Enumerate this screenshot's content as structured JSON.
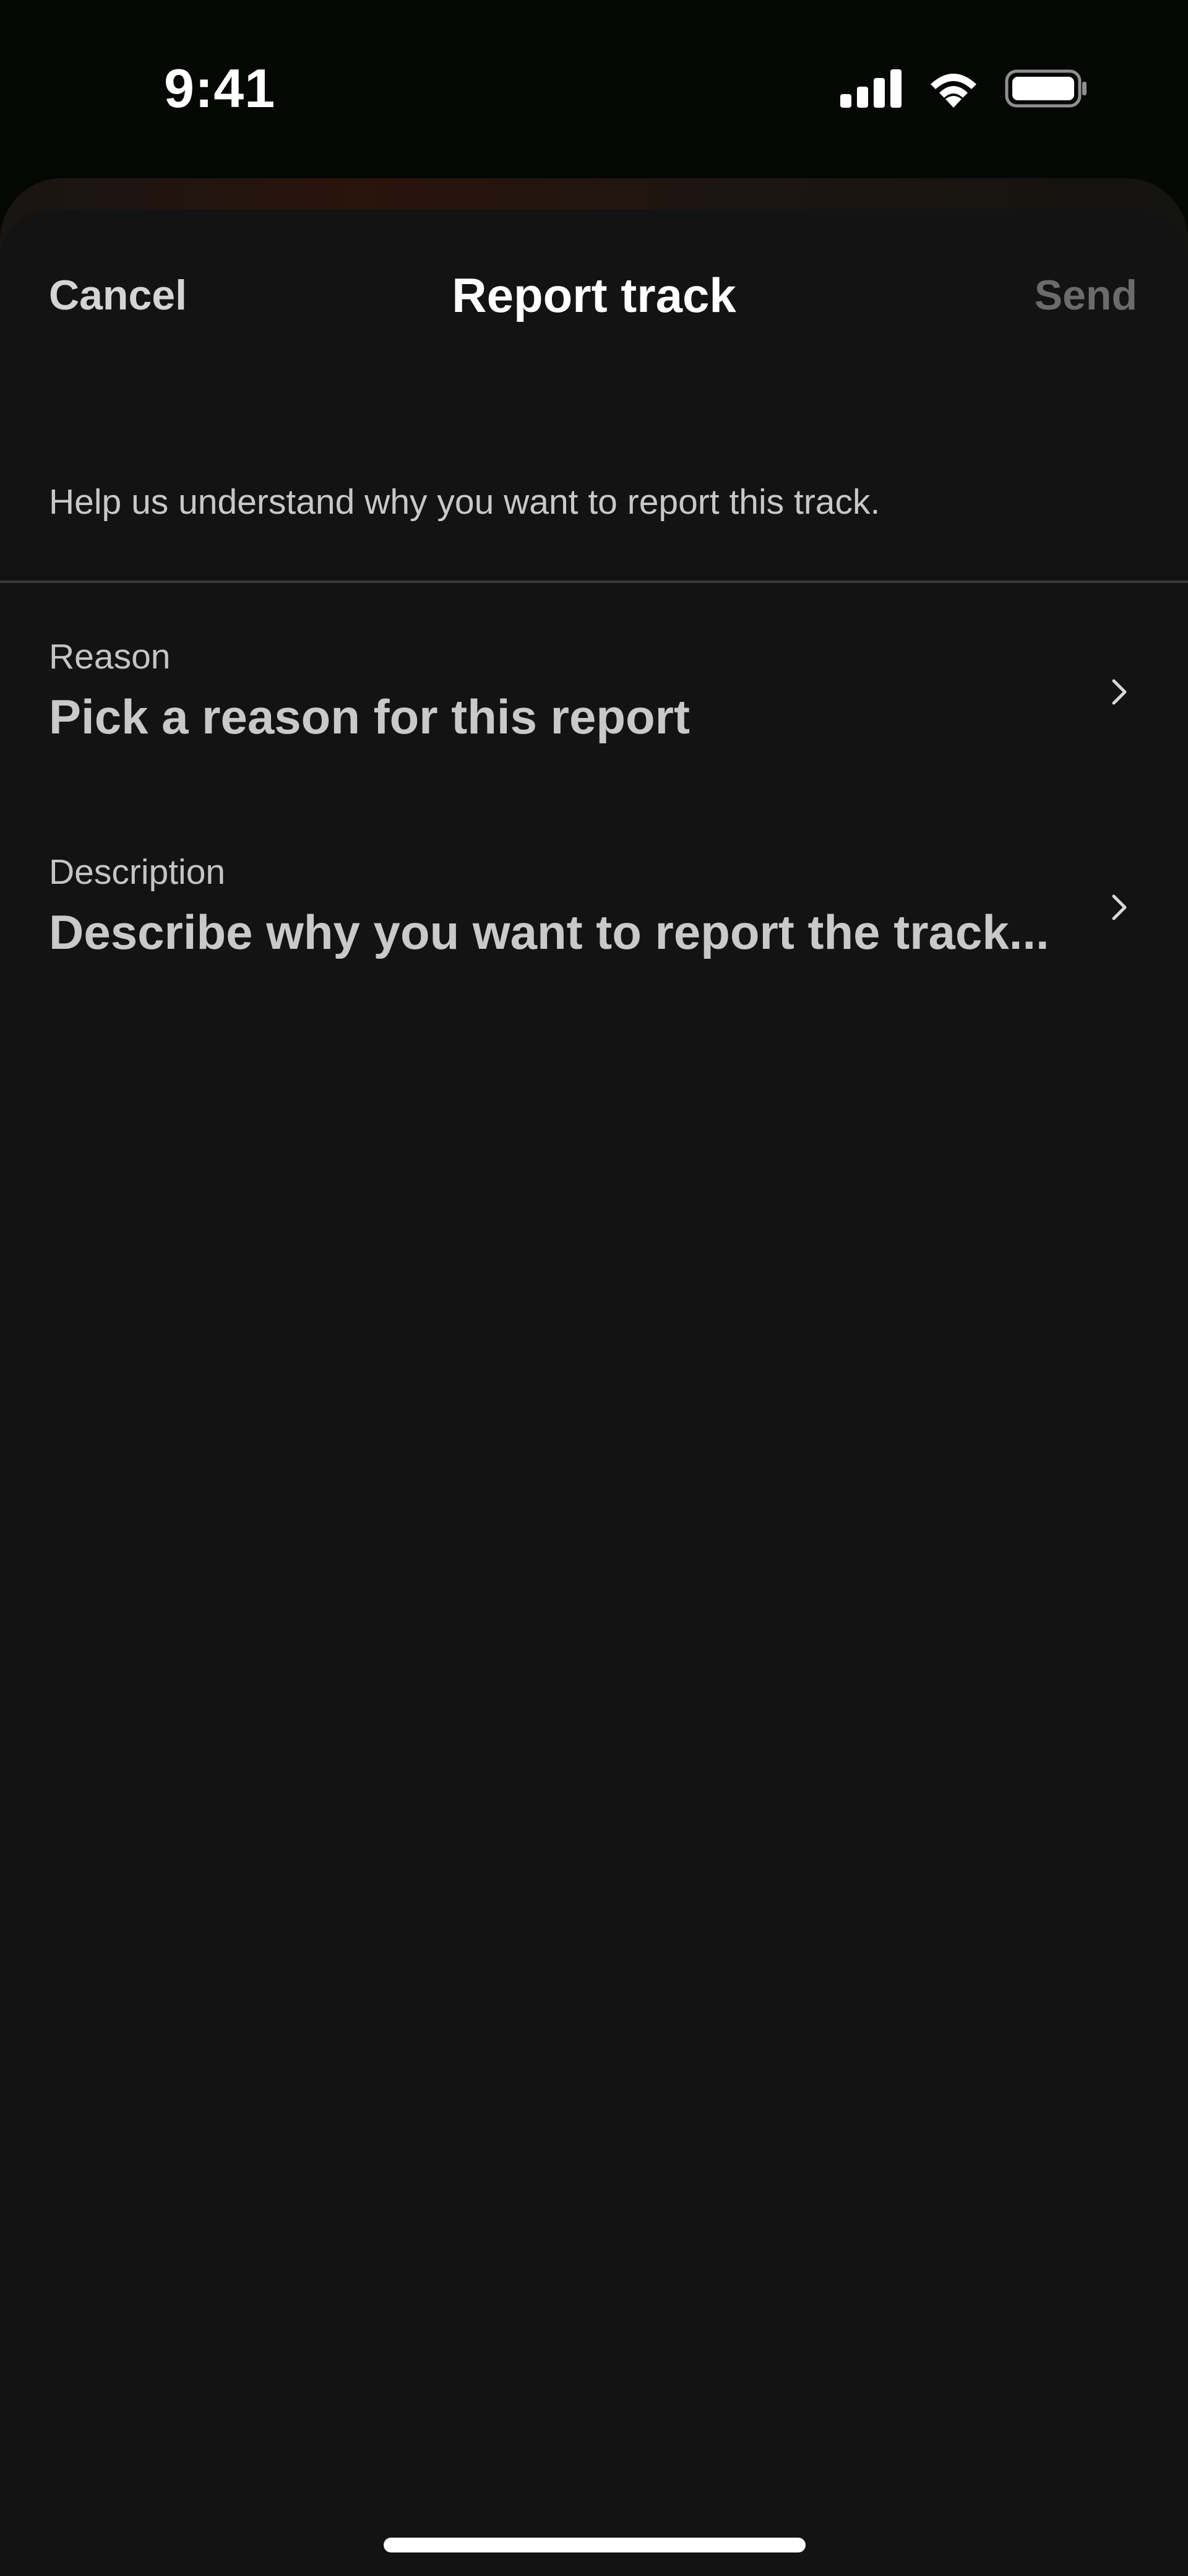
{
  "status_bar": {
    "time": "9:41",
    "icons": [
      "cellular-signal-icon",
      "wifi-icon",
      "battery-icon"
    ]
  },
  "nav": {
    "cancel_label": "Cancel",
    "title": "Report track",
    "send_label": "Send"
  },
  "intro": "Help us understand why you want to report this track.",
  "fields": [
    {
      "label": "Reason",
      "value": "Pick a reason for this report",
      "icon": "chevron-right-icon"
    },
    {
      "label": "Description",
      "value": "Describe why you want to report the track...",
      "icon": "chevron-right-icon"
    }
  ],
  "colors": {
    "sheet_background": "#131313",
    "screen_background": "#050705",
    "primary_text": "#ffffff",
    "secondary_text": "#c8c8c8",
    "disabled_text": "#6b6b6b",
    "divider": "#3a3a3a"
  }
}
